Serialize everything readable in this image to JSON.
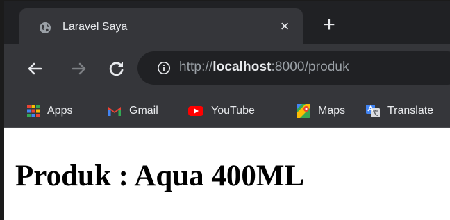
{
  "browser": {
    "tab": {
      "title": "Laravel Saya",
      "close_symbol": "×",
      "favicon": "globe-icon"
    },
    "new_tab_symbol": "+",
    "nav": {
      "back": "arrow-left-icon",
      "forward": "arrow-right-icon",
      "reload": "reload-icon"
    },
    "address": {
      "scheme": "http://",
      "host": "localhost",
      "rest": ":8000/produk",
      "info_icon": "info-icon"
    },
    "bookmarks": [
      {
        "label": "Apps",
        "icon": "apps-grid-icon"
      },
      {
        "label": "Gmail",
        "icon": "gmail-icon"
      },
      {
        "label": "YouTube",
        "icon": "youtube-icon"
      },
      {
        "label": "Maps",
        "icon": "maps-icon"
      },
      {
        "label": "Translate",
        "icon": "translate-icon"
      }
    ]
  },
  "page": {
    "heading": "Produk : Aqua 400ML"
  },
  "colors": {
    "tabstrip": "#202124",
    "toolbar": "#35363a",
    "text_light": "#e8eaed",
    "text_muted": "#9aa0a6"
  }
}
